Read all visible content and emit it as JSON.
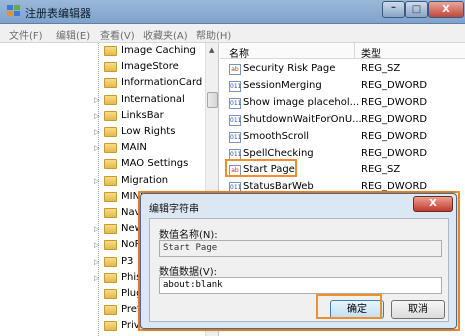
{
  "window": {
    "title": "注册表编辑器",
    "minimize": "–",
    "maximize": "□",
    "close": "X"
  },
  "menu": [
    "文件(F)",
    "编辑(E)",
    "查看(V)",
    "收藏夹(A)",
    "帮助(H)"
  ],
  "tree": {
    "items": [
      {
        "label": "Image Caching",
        "expandable": false
      },
      {
        "label": "ImageStore",
        "expandable": false
      },
      {
        "label": "InformationCard T",
        "expandable": false
      },
      {
        "label": "International",
        "expandable": true
      },
      {
        "label": "LinksBar",
        "expandable": true
      },
      {
        "label": "Low Rights",
        "expandable": true
      },
      {
        "label": "MAIN",
        "expandable": true
      },
      {
        "label": "MAO Settings",
        "expandable": false
      },
      {
        "label": "Migration",
        "expandable": true
      },
      {
        "label": "MINIE",
        "expandable": false
      },
      {
        "label": "Navi",
        "expandable": false
      },
      {
        "label": "New",
        "expandable": true
      },
      {
        "label": "NoR",
        "expandable": true
      },
      {
        "label": "P3",
        "expandable": true
      },
      {
        "label": "Phisl",
        "expandable": true
      },
      {
        "label": "Plug",
        "expandable": false
      },
      {
        "label": "Prefe",
        "expandable": false
      },
      {
        "label": "Priva",
        "expandable": false
      }
    ]
  },
  "list": {
    "headers": {
      "name": "名称",
      "type": "类型"
    },
    "rows": [
      {
        "name": "Security Risk Page",
        "type": "REG_SZ",
        "icon": "string-value-icon"
      },
      {
        "name": "SessionMerging",
        "type": "REG_DWORD",
        "icon": "dword-value-icon"
      },
      {
        "name": "Show image placehol...",
        "type": "REG_DWORD",
        "icon": "dword-value-icon"
      },
      {
        "name": "ShutdownWaitForOnU...",
        "type": "REG_DWORD",
        "icon": "dword-value-icon"
      },
      {
        "name": "SmoothScroll",
        "type": "REG_DWORD",
        "icon": "dword-value-icon"
      },
      {
        "name": "SpellChecking",
        "type": "REG_DWORD",
        "icon": "dword-value-icon"
      },
      {
        "name": "Start Page",
        "type": "REG_SZ",
        "icon": "string-value-icon"
      },
      {
        "name": "StatusBarWeb",
        "type": "REG_DWORD",
        "icon": "dword-value-icon"
      }
    ]
  },
  "dialog": {
    "title": "编辑字符串",
    "close": "X",
    "name_label": "数值名称(N):",
    "name_value": "Start Page",
    "data_label": "数值数据(V):",
    "data_value": "about:blank",
    "ok": "确定",
    "cancel": "取消"
  },
  "colors": {
    "accent_highlight": "#f0902a",
    "titlebar": "#7fa3cc",
    "close_button": "#c2453a"
  }
}
